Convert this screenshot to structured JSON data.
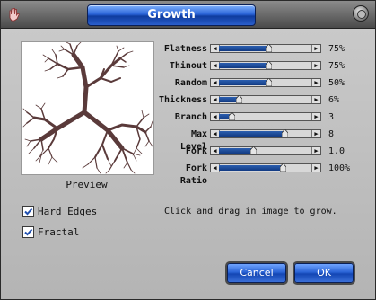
{
  "window": {
    "title": "Growth"
  },
  "preview": {
    "label": "Preview"
  },
  "sliders": [
    {
      "label": "Flatness",
      "value": "75%",
      "level": 0.52
    },
    {
      "label": "Thinout",
      "value": "75%",
      "level": 0.52
    },
    {
      "label": "Random",
      "value": "50%",
      "level": 0.52
    },
    {
      "label": "Thickness",
      "value": "6%",
      "level": 0.21
    },
    {
      "label": "Branch",
      "value": "3",
      "level": 0.13
    },
    {
      "label": "Max Level",
      "value": "8",
      "level": 0.69
    },
    {
      "label": "Fork",
      "value": "1.0",
      "level": 0.36
    },
    {
      "label": "Fork Ratio",
      "value": "100%",
      "level": 0.67
    }
  ],
  "options": {
    "hard_edges": {
      "label": "Hard Edges",
      "checked": true
    },
    "fractal": {
      "label": "Fractal",
      "checked": true
    }
  },
  "hint": "Click and drag in image to grow.",
  "buttons": {
    "cancel": "Cancel",
    "ok": "OK"
  },
  "colors": {
    "accent": "#1f4fb0",
    "tree": "#5a3a3a"
  }
}
